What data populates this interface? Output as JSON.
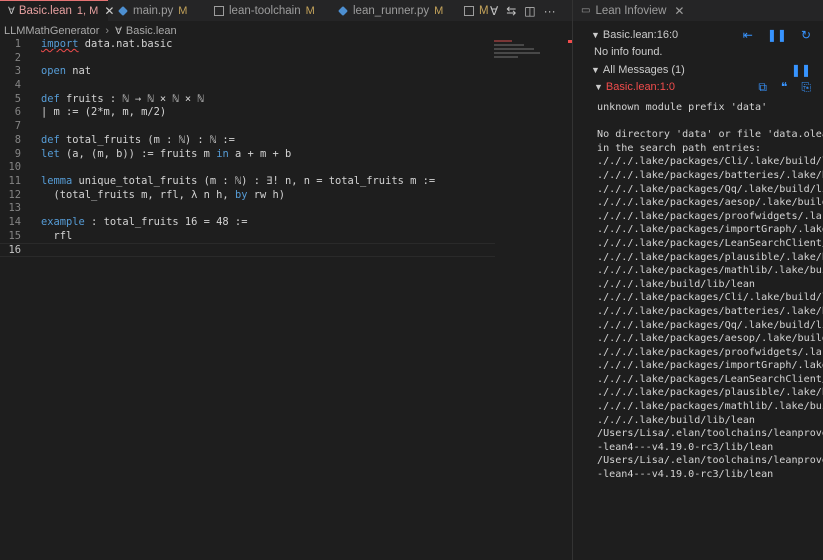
{
  "editor": {
    "tabs": [
      {
        "label": "Basic.lean",
        "status": "1, M",
        "icon": "lean-icon",
        "active": true
      },
      {
        "label": "main.py",
        "status": "M",
        "icon": "python-icon",
        "active": false
      },
      {
        "label": "lean-toolchain",
        "status": "M",
        "icon": "file-icon",
        "active": false
      },
      {
        "label": "lean_runner.py",
        "status": "M",
        "icon": "python-icon",
        "active": false
      },
      {
        "label": "M",
        "status": "",
        "icon": "file-icon",
        "active": false
      }
    ],
    "tab_actions": [
      "lean-forall-icon",
      "git-compare-icon",
      "split-editor-icon",
      "more-actions-icon"
    ],
    "breadcrumb": {
      "folder": "LLMMathGenerator",
      "file": "Basic.lean"
    },
    "code_lines": [
      {
        "n": "1",
        "segments": [
          {
            "t": "import",
            "c": "kw err"
          },
          {
            "t": " data.nat.basic",
            "c": ""
          }
        ]
      },
      {
        "n": "2",
        "segments": []
      },
      {
        "n": "3",
        "segments": [
          {
            "t": "open",
            "c": "kw"
          },
          {
            "t": " nat",
            "c": ""
          }
        ]
      },
      {
        "n": "4",
        "segments": []
      },
      {
        "n": "5",
        "segments": [
          {
            "t": "def",
            "c": "kw"
          },
          {
            "t": " fruits : ℕ → ℕ × ℕ × ℕ",
            "c": ""
          }
        ]
      },
      {
        "n": "6",
        "segments": [
          {
            "t": "| m := (2*m, m, m/2)",
            "c": ""
          }
        ]
      },
      {
        "n": "7",
        "segments": []
      },
      {
        "n": "8",
        "segments": [
          {
            "t": "def",
            "c": "kw"
          },
          {
            "t": " total_fruits (m : ℕ) : ℕ :=",
            "c": ""
          }
        ]
      },
      {
        "n": "9",
        "segments": [
          {
            "t": "let",
            "c": "kw"
          },
          {
            "t": " (a, (m, b)) := fruits m ",
            "c": ""
          },
          {
            "t": "in",
            "c": "kw"
          },
          {
            "t": " a + m + b",
            "c": ""
          }
        ]
      },
      {
        "n": "10",
        "segments": []
      },
      {
        "n": "11",
        "segments": [
          {
            "t": "lemma",
            "c": "kw"
          },
          {
            "t": " unique_total_fruits (m : ℕ) : ∃! n, n = total_fruits m :=",
            "c": ""
          }
        ]
      },
      {
        "n": "12",
        "segments": [
          {
            "t": "  (total_fruits m, rfl, λ n h, ",
            "c": ""
          },
          {
            "t": "by",
            "c": "kw"
          },
          {
            "t": " rw h)",
            "c": ""
          }
        ]
      },
      {
        "n": "13",
        "segments": []
      },
      {
        "n": "14",
        "segments": [
          {
            "t": "example",
            "c": "kw"
          },
          {
            "t": " : total_fruits 16 = 48 :=",
            "c": ""
          }
        ]
      },
      {
        "n": "15",
        "segments": [
          {
            "t": "  rfl",
            "c": ""
          }
        ]
      },
      {
        "n": "16",
        "segments": []
      }
    ]
  },
  "infoview": {
    "tab_label": "Lean Infoview",
    "goal_header": "Basic.lean:16:0",
    "no_info": "No info found.",
    "all_messages": "All Messages (1)",
    "message_location": "Basic.lean:1:0",
    "message_text": "unknown module prefix 'data'\n\nNo directory 'data' or file 'data.olean'\nin the search path entries:\n./././.lake/packages/Cli/.lake/build/lib/lean\n./././.lake/packages/batteries/.lake/build/lib/lean\n./././.lake/packages/Qq/.lake/build/lib/lean\n./././.lake/packages/aesop/.lake/build/lib/lean\n./././.lake/packages/proofwidgets/.lake/build/lib/lean\n./././.lake/packages/importGraph/.lake/build/lib/lean\n./././.lake/packages/LeanSearchClient/.lake/build/lib/lean\n./././.lake/packages/plausible/.lake/build/lib/lean\n./././.lake/packages/mathlib/.lake/build/lib/lean\n./././.lake/build/lib/lean\n./././.lake/packages/Cli/.lake/build/lib/lean\n./././.lake/packages/batteries/.lake/build/lib/lean\n./././.lake/packages/Qq/.lake/build/lib/lean\n./././.lake/packages/aesop/.lake/build/lib/lean\n./././.lake/packages/proofwidgets/.lake/build/lib/lean\n./././.lake/packages/importGraph/.lake/build/lib/lean\n./././.lake/packages/LeanSearchClient/.lake/build/lib/lean\n./././.lake/packages/plausible/.lake/build/lib/lean\n./././.lake/packages/mathlib/.lake/build/lib/lean\n./././.lake/build/lib/lean\n/Users/Lisa/.elan/toolchains/leanprover--\n-lean4---v4.19.0-rc3/lib/lean\n/Users/Lisa/.elan/toolchains/leanprover--\n-lean4---v4.19.0-rc3/lib/lean"
  },
  "colors": {
    "accent": "#3794ff",
    "error": "#f14c4c",
    "keyword": "#569cd6",
    "modified": "#c4a35a"
  }
}
